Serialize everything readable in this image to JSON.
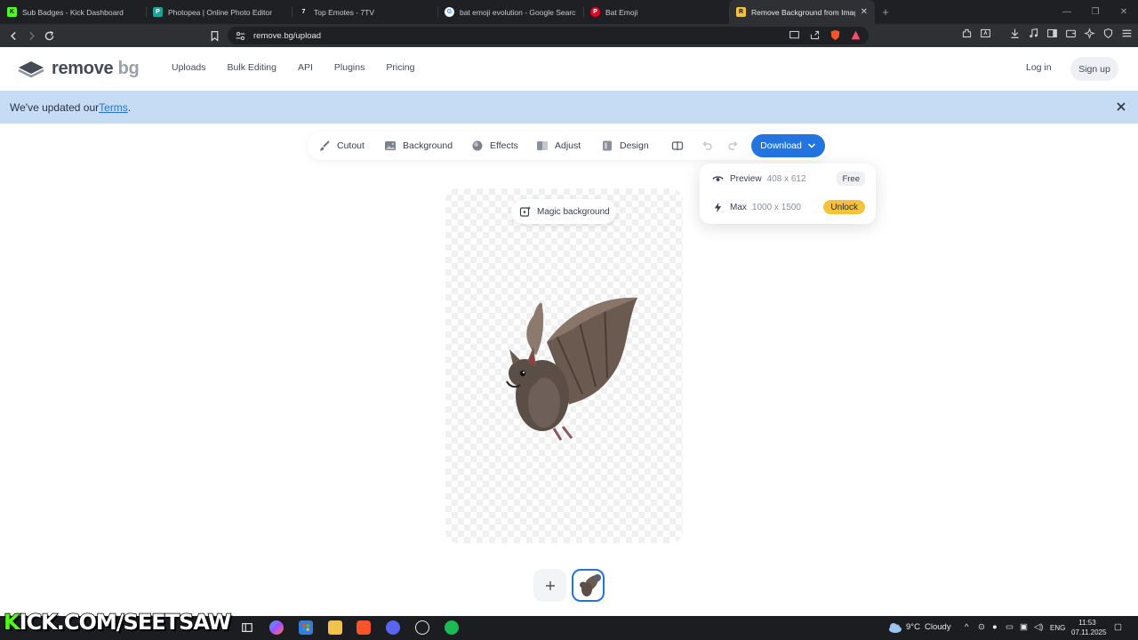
{
  "browser": {
    "tabs": [
      {
        "title": "Sub Badges - Kick Dashboard",
        "favicon_color": "#53fc18",
        "favicon_glyph": "K",
        "active": false
      },
      {
        "title": "Photopea | Online Photo Editor",
        "favicon_color": "#18a497",
        "favicon_glyph": "P",
        "active": false
      },
      {
        "title": "Top Emotes - 7TV",
        "favicon_color": "#ffffff",
        "favicon_glyph": "7",
        "active": false
      },
      {
        "title": "bat emoji evolution - Google Search",
        "favicon_color": "#ffffff",
        "favicon_glyph": "G",
        "active": false
      },
      {
        "title": "Bat Emoji",
        "favicon_color": "#e60023",
        "favicon_glyph": "P",
        "active": false
      },
      {
        "title": "Remove Background from Image",
        "favicon_color": "#f4c23d",
        "favicon_glyph": "R",
        "active": true
      }
    ],
    "new_tab_label": "+",
    "url": "remove.bg/upload"
  },
  "site": {
    "logo_text": "remove",
    "logo_suffix": "bg",
    "nav": [
      "Uploads",
      "Bulk Editing",
      "API",
      "Plugins",
      "Pricing"
    ],
    "login_label": "Log in",
    "signup_label": "Sign up"
  },
  "banner": {
    "prefix": "We've updated our ",
    "link": "Terms",
    "suffix": "."
  },
  "editor": {
    "tools": [
      {
        "label": "Cutout",
        "icon": "brush-icon"
      },
      {
        "label": "Background",
        "icon": "image-icon"
      },
      {
        "label": "Effects",
        "icon": "effects-icon"
      },
      {
        "label": "Adjust",
        "icon": "adjust-icon"
      },
      {
        "label": "Design",
        "icon": "design-icon"
      }
    ],
    "download_label": "Download",
    "magic_background_label": "Magic background"
  },
  "download_menu": {
    "preview": {
      "label": "Preview",
      "size": "408 x 612",
      "badge": "Free"
    },
    "max": {
      "label": "Max",
      "size": "1000 x 1500",
      "badge": "Unlock"
    }
  },
  "overlay": {
    "kick_k": "K",
    "kick_rest": "ICK.COM/SEETSAW"
  },
  "taskbar": {
    "weather_temp": "9°C",
    "weather_text": "Cloudy",
    "language": "ENG",
    "time": "11:53",
    "date": "07.11.2025"
  },
  "colors": {
    "accent": "#2374e1",
    "banner": "#c6dcf5",
    "unlock": "#f4c23d"
  }
}
